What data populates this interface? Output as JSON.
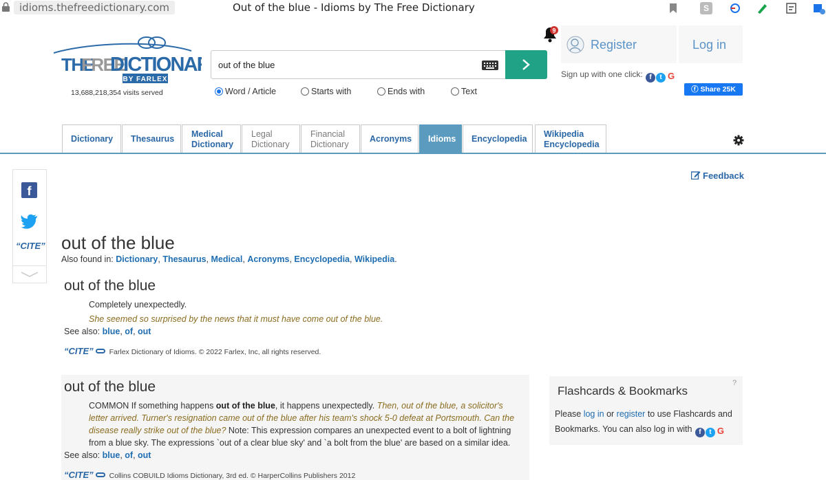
{
  "browser": {
    "url": "idioms.thefreedictionary.com",
    "title": "Out of the blue - Idioms by The Free Dictionary"
  },
  "header": {
    "visits": "13,688,218,354 visits served",
    "search_value": "out of the blue",
    "radios": [
      {
        "label": "Word / Article",
        "selected": true
      },
      {
        "label": "Starts with",
        "selected": false
      },
      {
        "label": "Ends with",
        "selected": false
      },
      {
        "label": "Text",
        "selected": false
      }
    ],
    "notification_count": "9",
    "register": "Register",
    "login": "Log in",
    "signup": "Sign up with one click:",
    "share": "Share 25K"
  },
  "tabs": [
    {
      "line1": "Dictionary",
      "line2": ""
    },
    {
      "line1": "Thesaurus",
      "line2": ""
    },
    {
      "line1": "Medical",
      "line2": "Dictionary"
    },
    {
      "line1": "Legal",
      "line2": "Dictionary"
    },
    {
      "line1": "Financial",
      "line2": "Dictionary"
    },
    {
      "line1": "Acronyms",
      "line2": ""
    },
    {
      "line1": "Idioms",
      "line2": ""
    },
    {
      "line1": "Encyclopedia",
      "line2": ""
    },
    {
      "line1": "Wikipedia",
      "line2": "Encyclopedia"
    }
  ],
  "feedback": "Feedback",
  "sidebar": {
    "cite": "“CITE”"
  },
  "main": {
    "title": "out of the blue",
    "also_found_label": "Also found in:",
    "also_found": [
      "Dictionary",
      "Thesaurus",
      "Medical",
      "Acronyms",
      "Encyclopedia",
      "Wikipedia"
    ],
    "entry1": {
      "heading": "out of the blue",
      "definition": "Completely unexpectedly.",
      "example": "She seemed so surprised by the news that it must have come out of the blue.",
      "see_also_label": "See also:",
      "see_also": [
        "blue",
        "of",
        "out"
      ],
      "cite": "“CITE”",
      "source": "Farlex Dictionary of Idioms. © 2022 Farlex, Inc, all rights reserved."
    },
    "entry2": {
      "heading": "out of the blue",
      "p_common": "COMMON If something happens ",
      "p_bold": "out of the blue",
      "p_after": ", it happens unexpectedly. ",
      "p_ex": "Then, out of the blue, a solicitor's letter arrived. Turner's resignation came out of the blue after his team's shock 5-0 defeat at Portsmouth. Can the disease really strike out of the blue?",
      "p_note": " Note: This expression compares an unexpected event to a bolt of lightning from a blue sky. The expressions `out of a clear blue sky' and `a bolt from the blue' are based on a similar idea.",
      "see_also_label": "See also:",
      "see_also": [
        "blue",
        "of",
        "out"
      ],
      "cite": "“CITE”",
      "source": "Collins COBUILD Idioms Dictionary, 3rd ed. © HarperCollins Publishers 2012"
    }
  },
  "flashcards": {
    "title": "Flashcards & Bookmarks",
    "help": "?",
    "t1": "Please ",
    "login": "log in",
    "t2": " or ",
    "register": "register",
    "t3": " to use Flashcards and Bookmarks. You can also log in with"
  }
}
